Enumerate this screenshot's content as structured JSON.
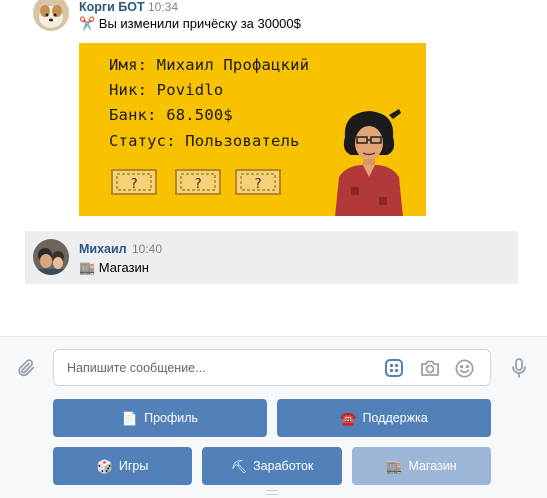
{
  "messages": [
    {
      "author": "Корги БОТ",
      "time": "10:34",
      "text": "✂️ Вы изменили причёску за 30000$",
      "card": {
        "lines": [
          "Имя: Михаил Профацкий",
          "Ник: Povidlo",
          "Банк: 68.500$",
          "Статус: Пользователь"
        ],
        "ticket_marks": [
          "?",
          "?",
          "?"
        ]
      }
    },
    {
      "author": "Михаил",
      "time": "10:40",
      "text": "🏬 Магазин"
    }
  ],
  "composer": {
    "placeholder": "Напишите сообщение..."
  },
  "keyboard": {
    "row1": [
      {
        "emoji": "📄",
        "label": "Профиль"
      },
      {
        "emoji": "☎️",
        "label": "Поддержка"
      }
    ],
    "row2": [
      {
        "emoji": "🎲",
        "label": "Игры"
      },
      {
        "emoji": "⛏",
        "label": "Заработок"
      },
      {
        "emoji": "🏬",
        "label": "Магазин"
      }
    ]
  },
  "colors": {
    "accent": "#5181b8",
    "author": "#2a5885",
    "card_bg": "#f8c200",
    "highlight_bg": "#edeef0"
  }
}
